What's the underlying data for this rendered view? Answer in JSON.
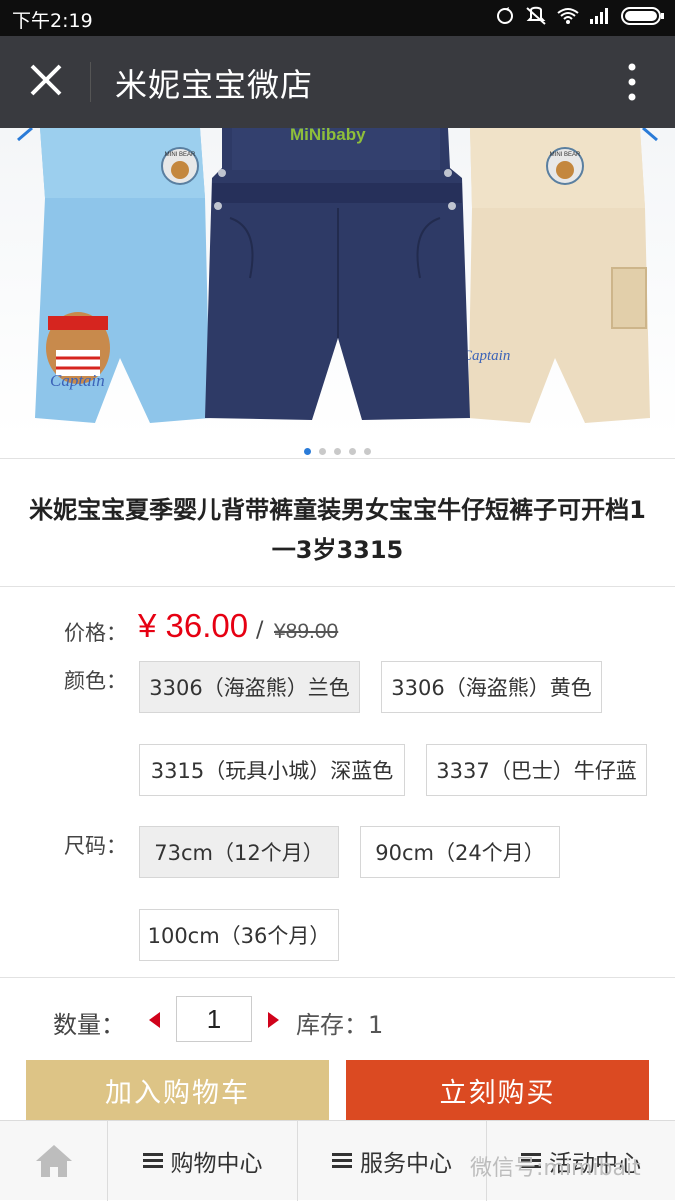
{
  "status_bar": {
    "time": "下午2:19"
  },
  "nav": {
    "title": "米妮宝宝微店"
  },
  "banner": {
    "slides": 5,
    "active_slide": 1,
    "brand_text": "MiNibaby",
    "patch_text": "MINI BEAR",
    "embroidery_text": "Captain"
  },
  "product": {
    "title": "米妮宝宝夏季婴儿背带裤童装男女宝宝牛仔短裤子可开档1一3岁3315",
    "price_label": "价格：",
    "price": "¥ 36.00",
    "slash": "/",
    "original_price": "¥89.00",
    "color_label": "颜色：",
    "colors": [
      {
        "label": "3306（海盗熊）兰色",
        "selected": true
      },
      {
        "label": "3306（海盗熊）黄色",
        "selected": false
      },
      {
        "label": "3315（玩具小城）深蓝色",
        "selected": false
      },
      {
        "label": "3337（巴士）牛仔蓝",
        "selected": false
      }
    ],
    "size_label": "尺码：",
    "sizes": [
      {
        "label": "73cm（12个月）",
        "selected": true
      },
      {
        "label": "90cm（24个月）",
        "selected": false
      },
      {
        "label": "100cm（36个月）",
        "selected": false
      }
    ],
    "quantity_label": "数量：",
    "quantity": "1",
    "stock_text": "库存：1"
  },
  "actions": {
    "add_to_cart": "加入购物车",
    "buy_now": "立刻购买"
  },
  "footer": {
    "tabs": [
      "购物中心",
      "服务中心",
      "活动中心"
    ],
    "watermark": "微信号:mimibait"
  },
  "colors": {
    "price_red": "#e60012",
    "cart_btn": "#ddc486",
    "buy_btn": "#db4a22",
    "navbar": "#393a3f"
  }
}
